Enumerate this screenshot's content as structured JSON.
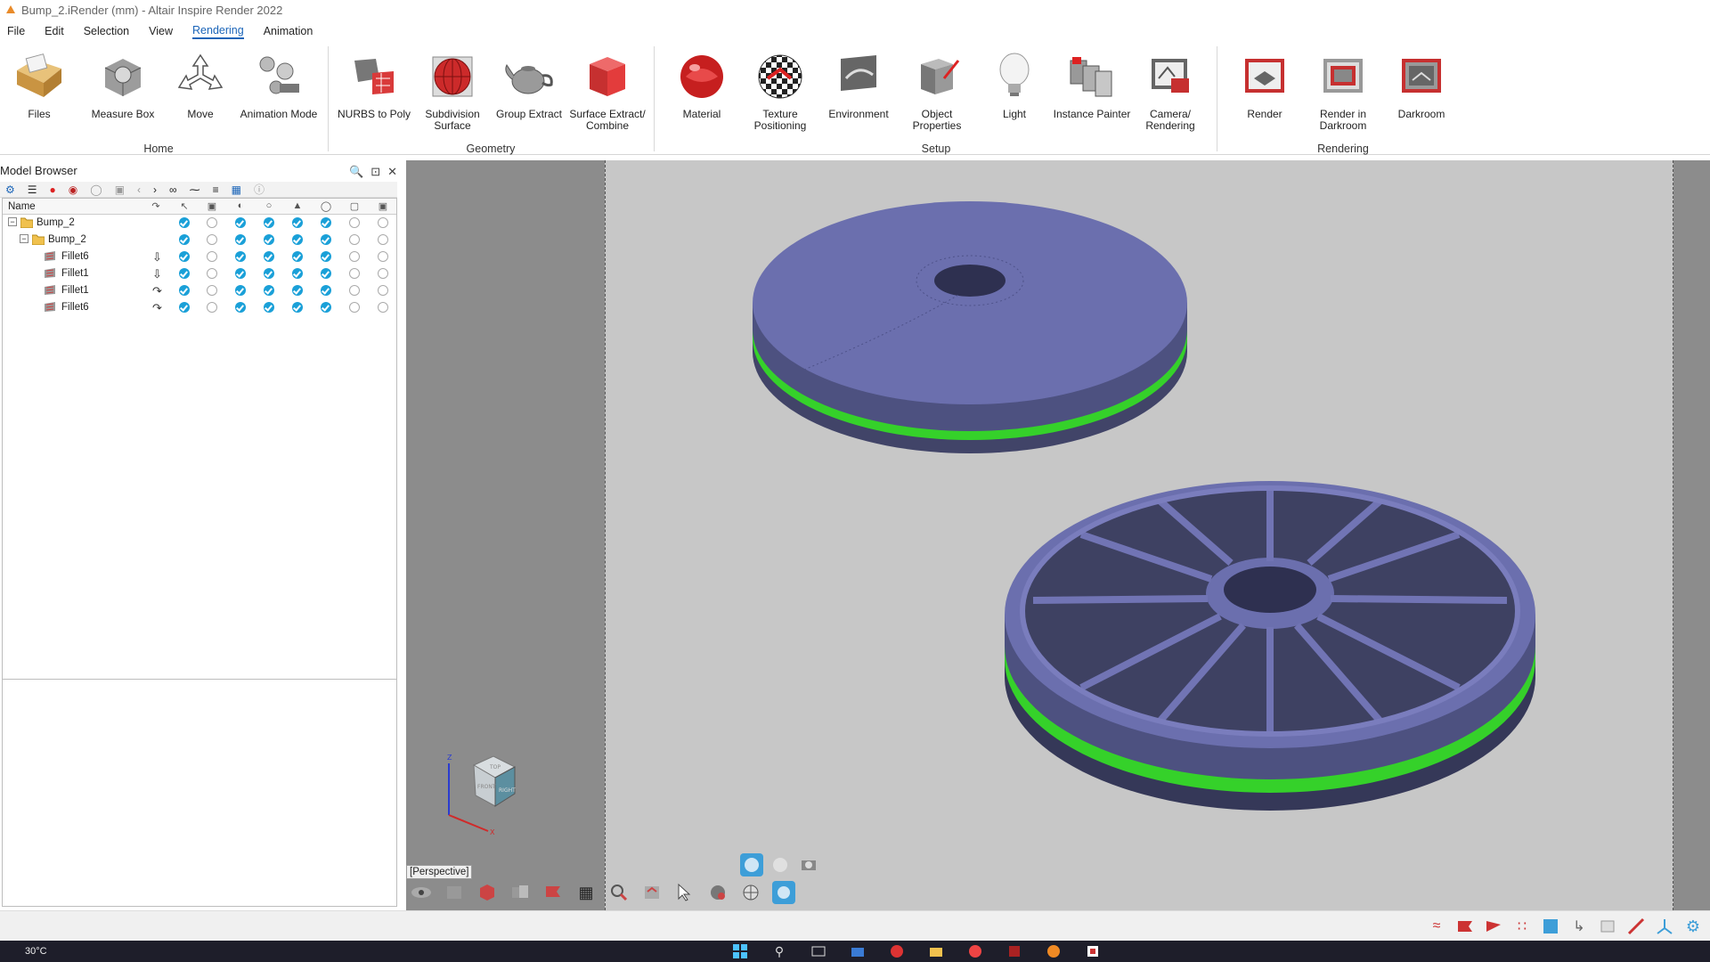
{
  "window": {
    "title": "Bump_2.iRender (mm) - Altair Inspire Render 2022"
  },
  "menu": [
    {
      "label": "File"
    },
    {
      "label": "Edit"
    },
    {
      "label": "Selection"
    },
    {
      "label": "View"
    },
    {
      "label": "Rendering",
      "active": true
    },
    {
      "label": "Animation"
    }
  ],
  "ribbon": {
    "groups": {
      "home": "Home",
      "geometry": "Geometry",
      "setup": "Setup",
      "rendering": "Rendering"
    },
    "tools": {
      "files": "Files",
      "measure_box": "Measure Box",
      "move": "Move",
      "animation_mode": "Animation Mode",
      "nurbs_to_poly": "NURBS to Poly",
      "subdivision_surface": "Subdivision\nSurface",
      "group_extract": "Group Extract",
      "surface_extract_combine": "Surface Extract/\nCombine",
      "material": "Material",
      "texture_positioning": "Texture\nPositioning",
      "environment": "Environment",
      "object_properties": "Object\nProperties",
      "light": "Light",
      "instance_painter": "Instance Painter",
      "camera_rendering": "Camera/\nRendering",
      "render": "Render",
      "render_in_darkroom": "Render in\nDarkroom",
      "darkroom": "Darkroom"
    }
  },
  "model_browser": {
    "title": "Model Browser",
    "column_name": "Name",
    "tree": [
      {
        "name": "Bump_2",
        "type": "folder",
        "level": 0
      },
      {
        "name": "Bump_2",
        "type": "folder",
        "level": 1
      },
      {
        "name": "Fillet6",
        "type": "surface",
        "level": 2
      },
      {
        "name": "Fillet1",
        "type": "surface",
        "level": 2
      },
      {
        "name": "Fillet1",
        "type": "surface",
        "level": 2
      },
      {
        "name": "Fillet6",
        "type": "surface",
        "level": 2
      }
    ]
  },
  "viewport": {
    "camera_label": "[Perspective]",
    "navcube": {
      "top": "TOP",
      "front": "FRONT",
      "right": "RIGHT"
    },
    "axes": {
      "z": "Z",
      "x": "X"
    }
  },
  "taskbar": {
    "weather": "30°C"
  },
  "colors": {
    "accent": "#1a64b8",
    "check_on": "#1aa0d8",
    "part_body": "#6b6fae",
    "part_band": "#35d12a",
    "viewport_bg": "#c7c7c7"
  }
}
